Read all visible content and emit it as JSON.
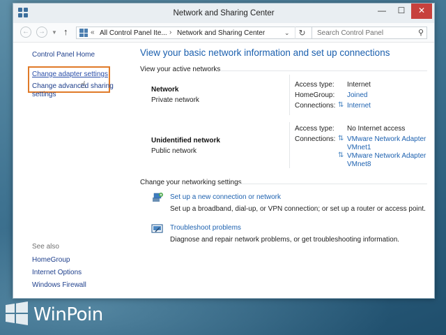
{
  "window": {
    "title": "Network and Sharing Center",
    "minimize_glyph": "—",
    "maximize_glyph": "☐",
    "close_glyph": "✕"
  },
  "navbar": {
    "breadcrumb_chevron": "«",
    "breadcrumb_part1": "All Control Panel Ite...",
    "breadcrumb_sep": "›",
    "breadcrumb_part2": "Network and Sharing Center",
    "search_placeholder": "Search Control Panel"
  },
  "sidebar": {
    "home": "Control Panel Home",
    "change_adapter": "Change adapter settings",
    "change_advanced": "Change advanced sharing settings",
    "see_also_label": "See also",
    "see_also": [
      "HomeGroup",
      "Internet Options",
      "Windows Firewall"
    ]
  },
  "main": {
    "title": "View your basic network information and set up connections",
    "active_networks_heading": "View your active networks",
    "networks": [
      {
        "name": "Network",
        "type": "Private network",
        "access_type_label": "Access type:",
        "access_type": "Internet",
        "homegroup_label": "HomeGroup:",
        "homegroup": "Joined",
        "connections_label": "Connections:",
        "connection": "Internet"
      },
      {
        "name": "Unidentified network",
        "type": "Public network",
        "access_type_label": "Access type:",
        "access_type": "No Internet access",
        "connections_label": "Connections:",
        "connections": [
          "VMware Network Adapter VMnet1",
          "VMware Network Adapter VMnet8"
        ]
      }
    ],
    "change_settings_heading": "Change your networking settings",
    "tasks": [
      {
        "link": "Set up a new connection or network",
        "description": "Set up a broadband, dial-up, or VPN connection; or set up a router or access point."
      },
      {
        "link": "Troubleshoot problems",
        "description": "Diagnose and repair network problems, or get troubleshooting information."
      }
    ]
  },
  "watermark": {
    "text": "WinPoin"
  },
  "colors": {
    "link": "#1e62b0",
    "title_blue": "#1a5fae",
    "highlight_border": "#e07a28",
    "close_button": "#c7413d"
  }
}
